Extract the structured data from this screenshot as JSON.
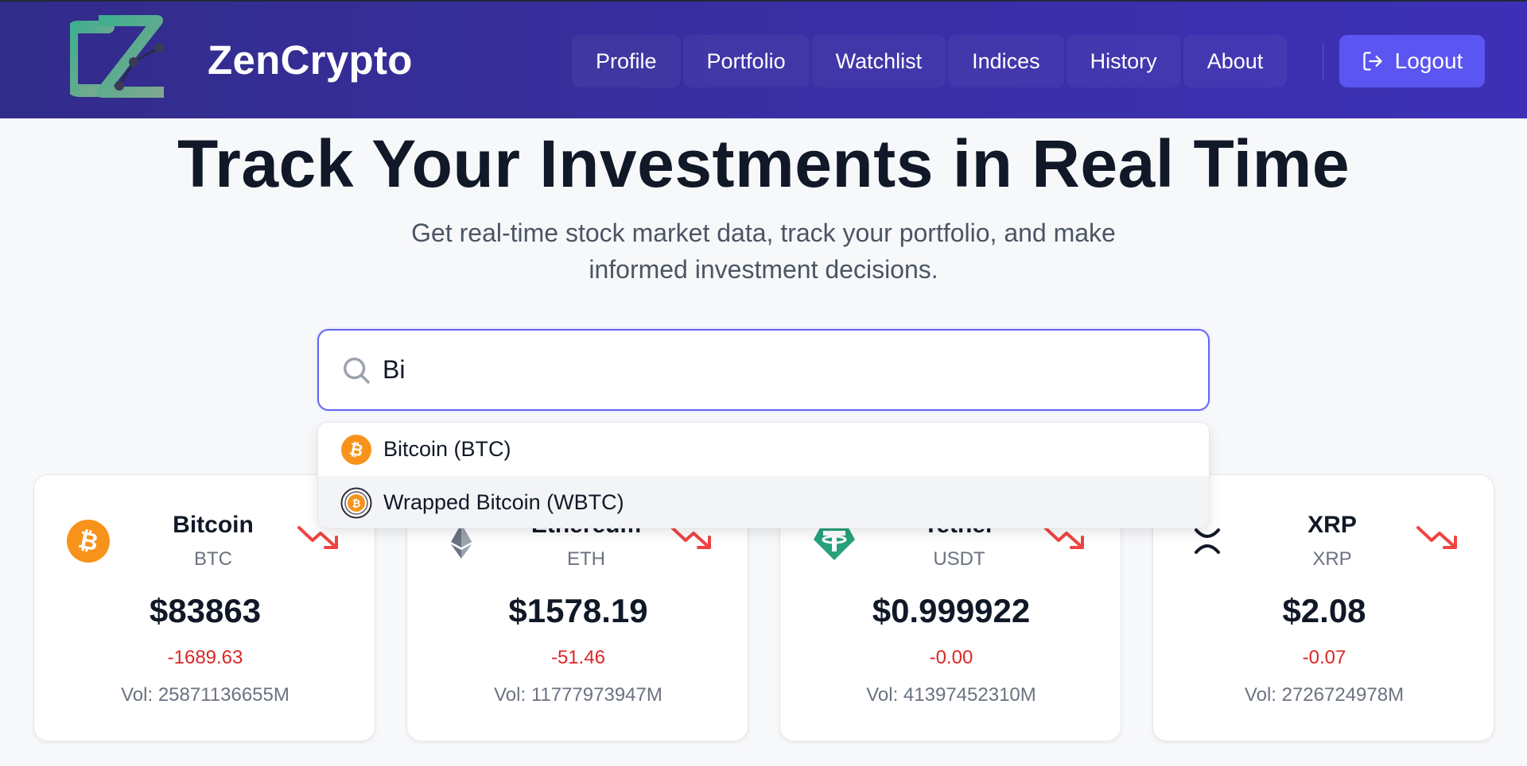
{
  "header": {
    "brand": "ZenCrypto",
    "nav": [
      "Profile",
      "Portfolio",
      "Watchlist",
      "Indices",
      "History",
      "About"
    ],
    "logout_label": "Logout",
    "colors": {
      "header_start": "#322c8a",
      "header_end": "#3d30b6",
      "logout_bg": "#5b55f2"
    }
  },
  "hero": {
    "title": "Track Your Investments in Real Time",
    "subtitle_line1": "Get real-time stock market data, track your portfolio, and make",
    "subtitle_line2": "informed investment decisions."
  },
  "search": {
    "value": "Bi",
    "icon": "search-icon"
  },
  "dropdown": {
    "items": [
      {
        "label": "Bitcoin (BTC)",
        "icon": "bitcoin-icon",
        "highlighted": false
      },
      {
        "label": "Wrapped Bitcoin (WBTC)",
        "icon": "wrapped-bitcoin-icon",
        "highlighted": true
      }
    ]
  },
  "cards": [
    {
      "name": "Bitcoin",
      "symbol": "BTC",
      "price": "$83863",
      "change": "-1689.63",
      "volume": "Vol: 25871136655M",
      "icon": "bitcoin-icon",
      "trend": "trending-down-icon"
    },
    {
      "name": "Ethereum",
      "symbol": "ETH",
      "price": "$1578.19",
      "change": "-51.46",
      "volume": "Vol: 11777973947M",
      "icon": "ethereum-icon",
      "trend": "trending-down-icon"
    },
    {
      "name": "Tether",
      "symbol": "USDT",
      "price": "$0.999922",
      "change": "-0.00",
      "volume": "Vol: 41397452310M",
      "icon": "tether-icon",
      "trend": "trending-down-icon"
    },
    {
      "name": "XRP",
      "symbol": "XRP",
      "price": "$2.08",
      "change": "-0.07",
      "volume": "Vol: 2726724978M",
      "icon": "xrp-icon",
      "trend": "trending-down-icon"
    }
  ],
  "colors": {
    "negative": "#dc2626",
    "accent": "#6366f1",
    "bitcoin": "#f7931a",
    "tether": "#26a17b"
  }
}
